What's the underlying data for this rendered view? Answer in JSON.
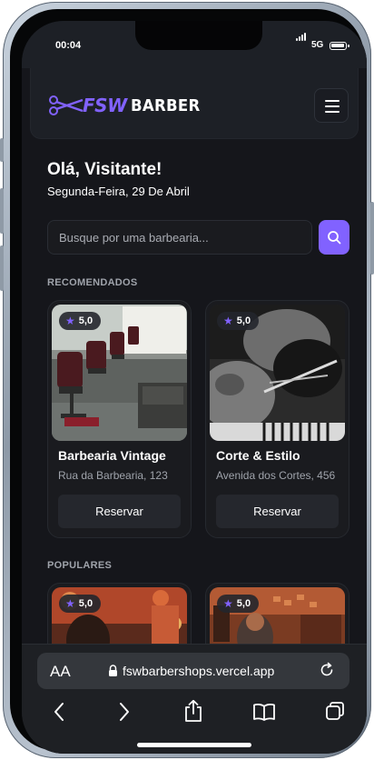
{
  "status_bar": {
    "time": "00:04",
    "network": "5G"
  },
  "header": {
    "brand": "FSW",
    "brand_suffix": "BARBER"
  },
  "greeting": {
    "title": "Olá, Visitante!",
    "date": "Segunda-Feira, 29 De Abril"
  },
  "search": {
    "placeholder": "Busque por uma barbearia..."
  },
  "sections": {
    "recommended": "RECOMENDADOS",
    "popular": "POPULARES"
  },
  "recommended": [
    {
      "name": "Barbearia Vintage",
      "address": "Rua da Barbearia, 123",
      "rating": "5,0",
      "button": "Reservar"
    },
    {
      "name": "Corte & Estilo",
      "address": "Avenida dos Cortes, 456",
      "rating": "5,0",
      "button": "Reservar"
    }
  ],
  "popular": [
    {
      "rating": "5,0"
    },
    {
      "rating": "5,0"
    }
  ],
  "browser": {
    "text_size_label": "AA",
    "url": "fswbarbershops.vercel.app"
  },
  "colors": {
    "accent": "#8162ff",
    "background": "#15161b",
    "card": "#1a1b1f"
  }
}
